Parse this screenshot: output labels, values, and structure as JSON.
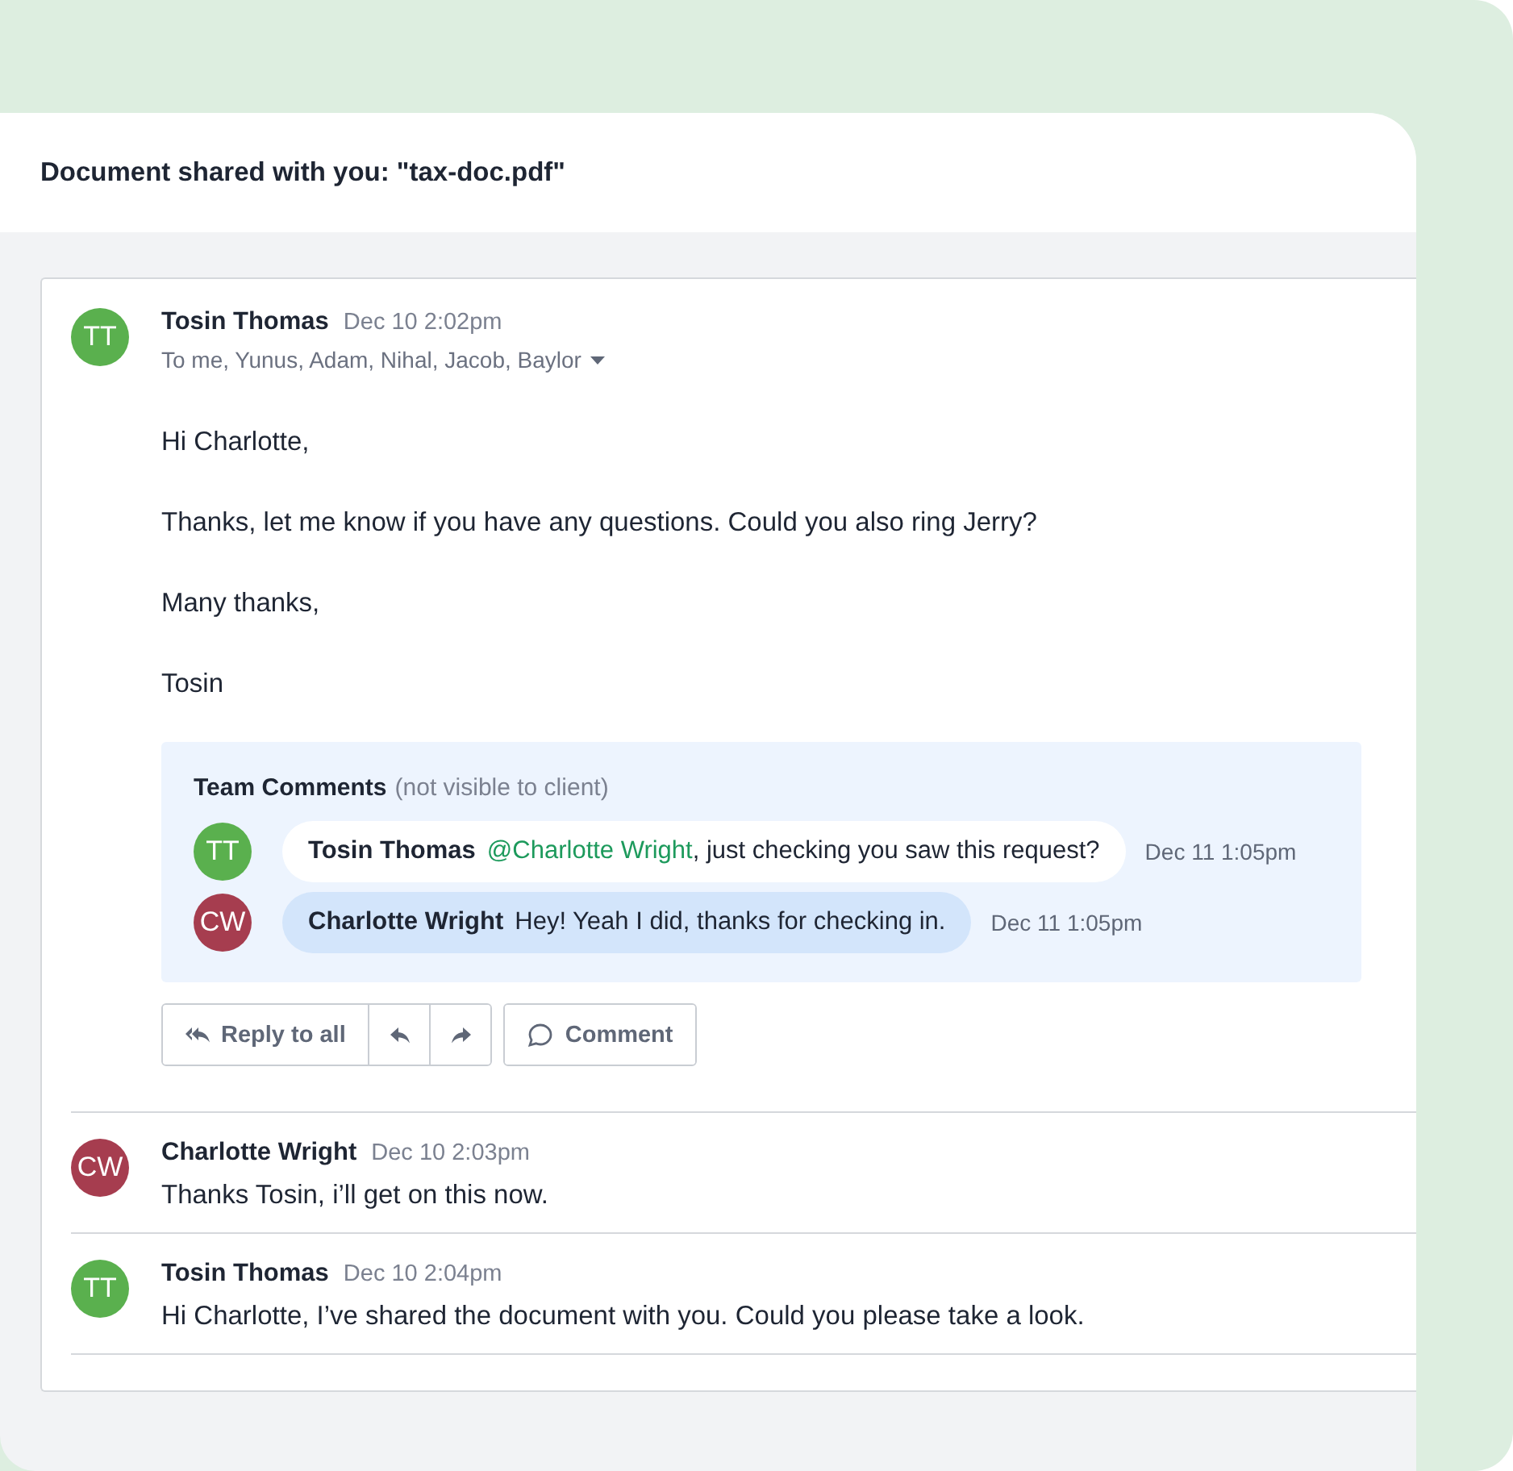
{
  "header": {
    "title": "Document shared with you: \"tax-doc.pdf\""
  },
  "messages": [
    {
      "kind": "full",
      "avatar": {
        "initials": "TT",
        "color": "#5ab04e"
      },
      "sender": "Tosin Thomas",
      "time": "Dec 10 2:02pm",
      "recipients": "To me, Yunus, Adam, Nihal, Jacob, Baylor",
      "body": [
        "Hi Charlotte,",
        "Thanks, let me know if you have any questions. Could you also ring Jerry?",
        "Many thanks,",
        "Tosin"
      ],
      "team_comments": {
        "title": "Team Comments",
        "note": "(not visible to client)",
        "comments": [
          {
            "avatar": {
              "initials": "TT",
              "color": "#5ab04e"
            },
            "author": "Tosin Thomas",
            "mention": "@Charlotte Wright",
            "text": ", just checking you saw this request?",
            "time": "Dec 11 1:05pm",
            "color": "#ffffff"
          },
          {
            "avatar": {
              "initials": "CW",
              "color": "#a63d4f"
            },
            "author": "Charlotte Wright",
            "text": "Hey! Yeah I did, thanks for checking in.",
            "time": "Dec 11 1:05pm",
            "color": "#d3e5fb"
          }
        ]
      },
      "actions": [
        {
          "kind": "reply_all",
          "label": "Reply to all"
        },
        {
          "kind": "reply"
        },
        {
          "kind": "forward"
        },
        {
          "kind": "comment",
          "label": "Comment"
        }
      ]
    },
    {
      "kind": "short",
      "avatar": {
        "initials": "CW",
        "color": "#a63d4f"
      },
      "sender": "Charlotte Wright",
      "time": "Dec 10 2:03pm",
      "body": [
        "Thanks Tosin, i’ll get on this now."
      ]
    },
    {
      "kind": "short",
      "avatar": {
        "initials": "TT",
        "color": "#5ab04e"
      },
      "sender": "Tosin Thomas",
      "time": "Dec 10 2:04pm",
      "body": [
        "Hi Charlotte, I’ve shared the document with you. Could you please take a look."
      ]
    }
  ]
}
